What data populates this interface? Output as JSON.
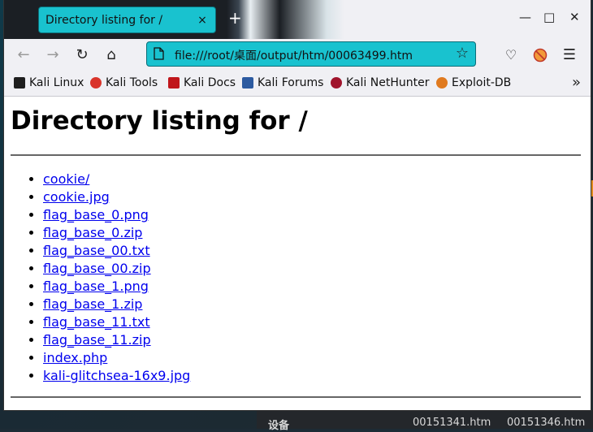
{
  "browser": {
    "tab_title": "Directory listing for /",
    "tab_close": "×",
    "new_tab": "+",
    "url": "file:///root/桌面/output/htm/00063499.htm"
  },
  "bookmarks": [
    {
      "label": "Kali Linux",
      "color": "#1e1e1e"
    },
    {
      "label": "Kali Tools",
      "color": "#d9342b"
    },
    {
      "label": "Kali Docs",
      "color": "#c0161b"
    },
    {
      "label": "Kali Forums",
      "color": "#2c5aa0"
    },
    {
      "label": "Kali NetHunter",
      "color": "#a0142c"
    },
    {
      "label": "Exploit-DB",
      "color": "#e07a1f"
    }
  ],
  "page": {
    "heading": "Directory listing for /",
    "files": [
      "cookie/",
      "cookie.jpg",
      "flag_base_0.png",
      "flag_base_0.zip",
      "flag_base_00.txt",
      "flag_base_00.zip",
      "flag_base_1.png",
      "flag_base_1.zip",
      "flag_base_11.txt",
      "flag_base_11.zip",
      "index.php",
      "kali-glitchsea-16x9.jpg"
    ]
  },
  "desktop": {
    "strip_label": "设备",
    "file_a": "00151341.htm",
    "file_b": "00151346.htm"
  },
  "colors": {
    "accent": "#19c2cf",
    "link": "#0000ee"
  }
}
